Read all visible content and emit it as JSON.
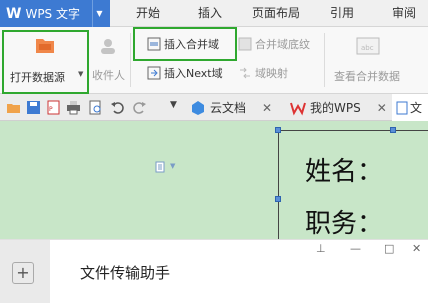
{
  "app": {
    "logo": "W",
    "title": "WPS 文字"
  },
  "menu": {
    "tabs": [
      "开始",
      "插入",
      "页面布局",
      "引用",
      "审阅"
    ]
  },
  "ribbon": {
    "open_data_source": "打开数据源",
    "recipients": "收件人",
    "insert_merge_field": "插入合并域",
    "merge_field_shading": "合并域底纹",
    "insert_next_field": "插入Next域",
    "field_mapping": "域映射",
    "view_merged_data": "查看合并数据"
  },
  "doc_tabs": [
    {
      "label": "云文档"
    },
    {
      "label": "我的WPS"
    },
    {
      "label": "文"
    }
  ],
  "document": {
    "line1": "姓名：",
    "line2": "职务："
  },
  "popup": {
    "title": "文件传输助手",
    "add_label": "+"
  },
  "colors": {
    "accent": "#3d7ad2",
    "highlight": "#2fa82f",
    "doc_bg": "#c8e6c8"
  }
}
